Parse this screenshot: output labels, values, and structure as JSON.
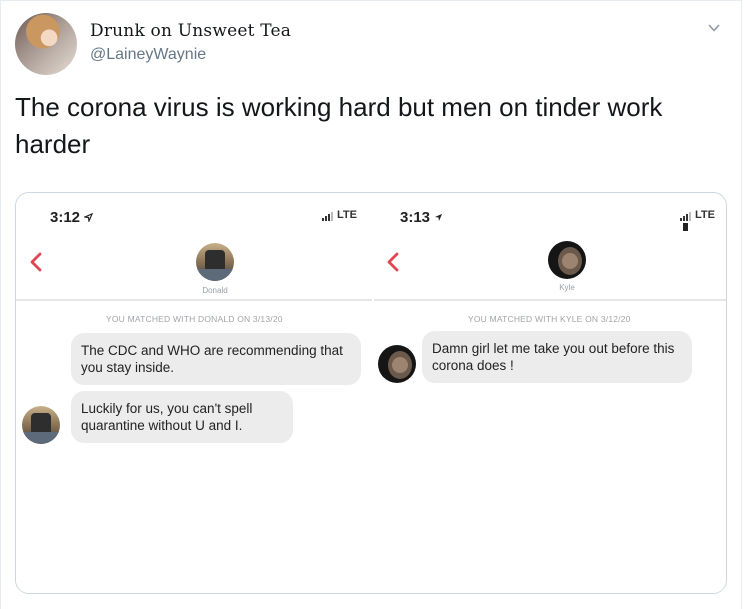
{
  "tweet": {
    "display_name": "Drunk on Unsweet Tea",
    "handle": "@LaineyWaynie",
    "text": "The corona virus is working hard but men on tinder work harder"
  },
  "icons": {
    "caret": "chevron-down-icon",
    "back": "chevron-left-icon",
    "signal": "cellular-signal-icon",
    "location": "location-arrow-icon",
    "battery": "battery-icon"
  },
  "colors": {
    "back_arrow": "#e0464f",
    "bubble": "#ececec",
    "handle": "#657786"
  },
  "screenshots": {
    "left": {
      "time": "3:12",
      "network": "LTE",
      "match_name": "Donald",
      "matched_line": "YOU MATCHED WITH DONALD ON 3/13/20",
      "messages": [
        "The CDC and WHO are recommending that you stay inside.",
        "Luckily for us, you can't spell quarantine without U and I."
      ]
    },
    "right": {
      "time": "3:13",
      "network": "LTE",
      "match_name": "Kyle",
      "matched_line": "YOU MATCHED WITH KYLE ON 3/12/20",
      "messages": [
        "Damn girl let me take you out before this corona does !"
      ]
    }
  }
}
